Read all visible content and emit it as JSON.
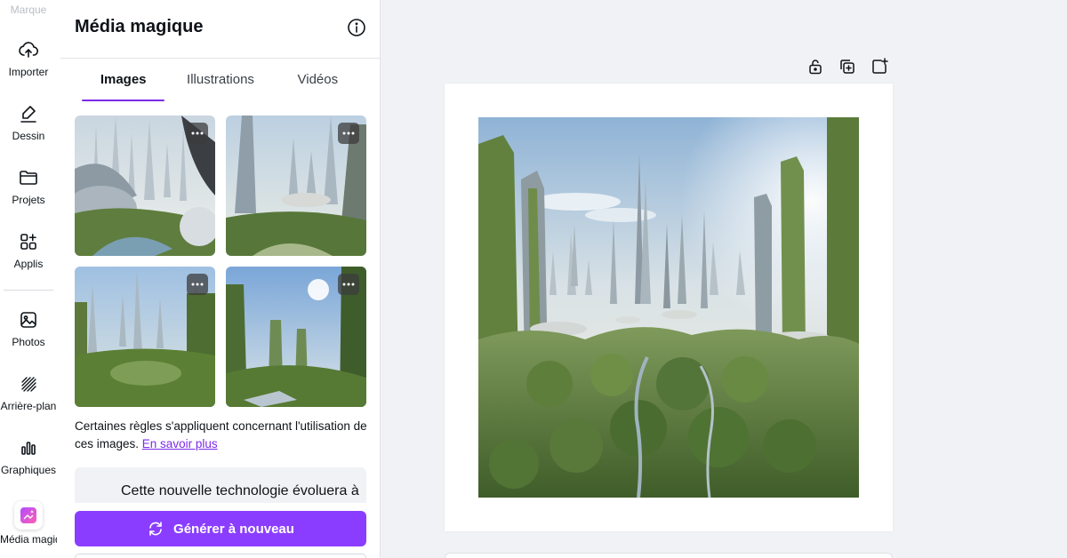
{
  "rail": {
    "brand_label": "Marque",
    "items": [
      {
        "label": "Importer",
        "icon": "cloud-upload-icon"
      },
      {
        "label": "Dessin",
        "icon": "pen-icon"
      },
      {
        "label": "Projets",
        "icon": "folder-icon"
      },
      {
        "label": "Applis",
        "icon": "apps-icon"
      },
      {
        "label": "Photos",
        "icon": "photo-icon"
      },
      {
        "label": "Arrière-plan",
        "icon": "background-pattern-icon"
      },
      {
        "label": "Graphiques",
        "icon": "bar-chart-icon"
      },
      {
        "label": "Média magique",
        "icon": "magic-media-icon"
      }
    ]
  },
  "panel": {
    "title": "Média magique",
    "tabs": [
      {
        "label": "Images",
        "active": true
      },
      {
        "label": "Illustrations",
        "active": false
      },
      {
        "label": "Vidéos",
        "active": false
      }
    ],
    "notice_text": "Certaines règles s'appliquent concernant l'utilisation de ces images.",
    "notice_link": "En savoir plus",
    "prompt_text": "Cette nouvelle technologie évoluera à",
    "generate_label": "Générer à nouveau"
  },
  "colors": {
    "accent": "#8b3dff",
    "link": "#7d2ae8",
    "canvas_bg": "#f1f2f5"
  }
}
